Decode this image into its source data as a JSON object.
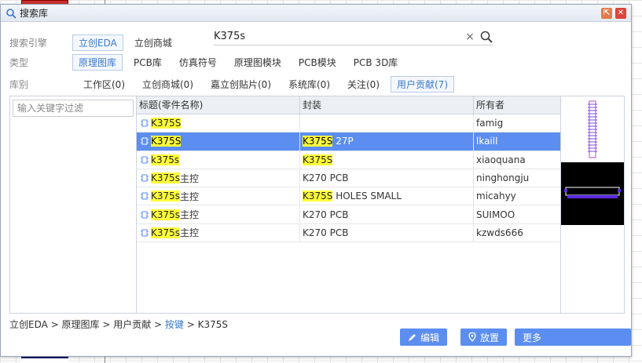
{
  "dialog": {
    "title": "搜索库",
    "controls": {
      "maximize": "⇱",
      "close": "✕"
    }
  },
  "engine": {
    "label": "搜索引擎",
    "options": [
      "立创EDA",
      "立创商城"
    ],
    "selected": 0
  },
  "search": {
    "value": "K375s",
    "clear": "×"
  },
  "type": {
    "label": "类型",
    "options": [
      "原理图库",
      "PCB库",
      "仿真符号",
      "原理图模块",
      "PCB模块",
      "PCB 3D库"
    ],
    "selected": 0
  },
  "library": {
    "label": "库别",
    "options": [
      "工作区(0)",
      "立创商城(0)",
      "嘉立创贴片(0)",
      "系统库(0)",
      "关注(0)",
      "用户贡献(7)"
    ],
    "selected": 5
  },
  "filter": {
    "placeholder": "输入关键字过滤"
  },
  "table": {
    "headers": [
      "标题(零件名称)",
      "封装",
      "所有者"
    ],
    "rows": [
      {
        "title_hl": "K375S",
        "title_rest": "",
        "pkg_hl": "",
        "pkg_rest": "",
        "owner": "famig",
        "selected": false
      },
      {
        "title_hl": "K375S",
        "title_rest": "",
        "pkg_hl": "K375S",
        "pkg_rest": " 27P",
        "owner": "lkaill",
        "selected": true
      },
      {
        "title_hl": "k375s",
        "title_rest": "",
        "pkg_hl": "K375S",
        "pkg_rest": "",
        "owner": "xiaoquana",
        "selected": false
      },
      {
        "title_hl": "K375s",
        "title_rest": "主控",
        "pkg_hl": "",
        "pkg_rest": "K270 PCB",
        "owner": "ninghongju",
        "selected": false
      },
      {
        "title_hl": "K375s",
        "title_rest": "主控",
        "pkg_hl": "K375S",
        "pkg_rest": " HOLES SMALL",
        "owner": "micahyy",
        "selected": false
      },
      {
        "title_hl": "K375s",
        "title_rest": "主控",
        "pkg_hl": "",
        "pkg_rest": "K270 PCB",
        "owner": "SUIMOO",
        "selected": false
      },
      {
        "title_hl": "K375s",
        "title_rest": "主控",
        "pkg_hl": "",
        "pkg_rest": "K270 PCB",
        "owner": "kzwds666",
        "selected": false
      }
    ]
  },
  "breadcrumb": {
    "parts": [
      "立创EDA",
      "原理图库",
      "用户贡献",
      "按键",
      "K375S"
    ],
    "separator": " > ",
    "link_index": 3
  },
  "buttons": {
    "edit": "编辑",
    "place": "放置",
    "more": "更多"
  },
  "colors": {
    "accent": "#5b8ef0",
    "highlight": "#ffff3a",
    "link": "#3a78c8"
  }
}
